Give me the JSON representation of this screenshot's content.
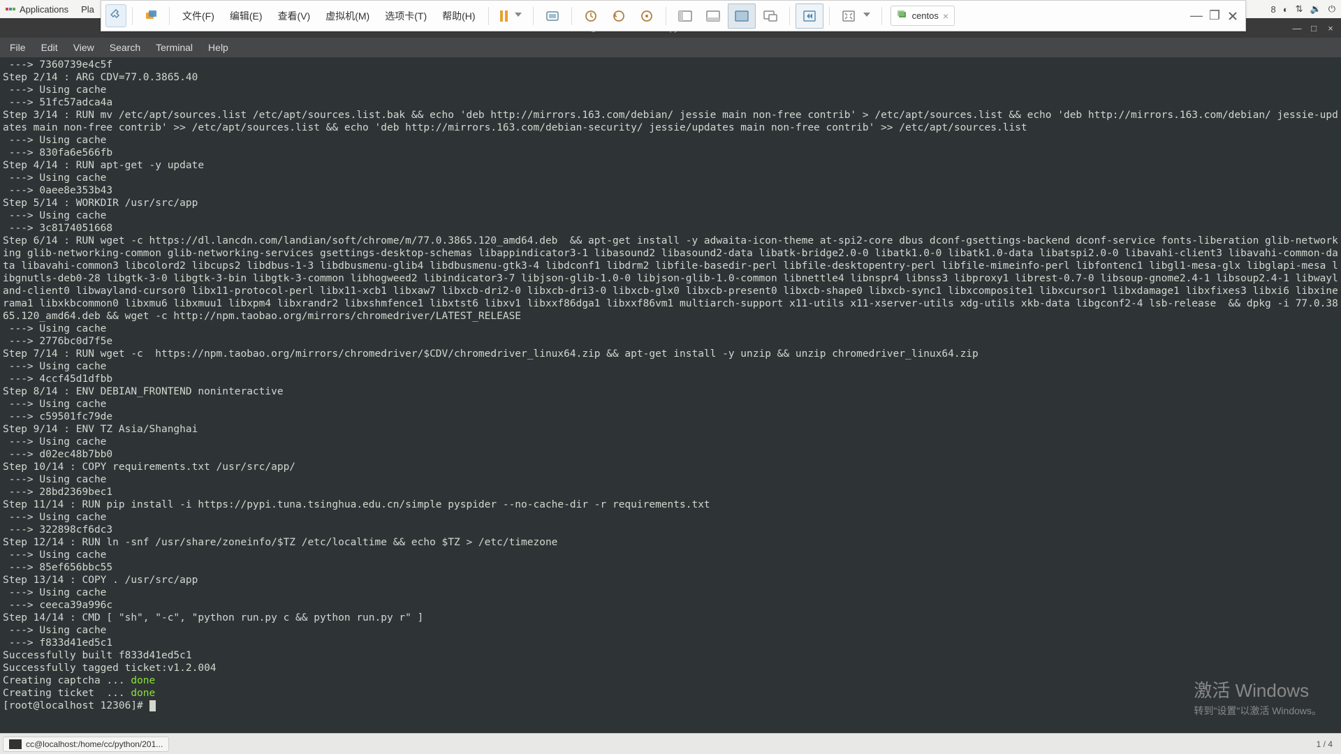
{
  "gnome": {
    "applications": "Applications",
    "places": "Pla",
    "tray_badge": "8"
  },
  "vm_toolbar": {
    "menus": [
      "文件(F)",
      "编辑(E)",
      "查看(V)",
      "虚拟机(M)",
      "选项卡(T)",
      "帮助(H)"
    ],
    "tab_label": "centos"
  },
  "terminal": {
    "title": "cc@localhost:/home/cc/python/20191225/12306",
    "menubar": [
      "File",
      "Edit",
      "View",
      "Search",
      "Terminal",
      "Help"
    ],
    "lines": [
      " ---> 7360739e4c5f",
      "Step 2/14 : ARG CDV=77.0.3865.40",
      " ---> Using cache",
      " ---> 51fc57adca4a",
      "Step 3/14 : RUN mv /etc/apt/sources.list /etc/apt/sources.list.bak && echo 'deb http://mirrors.163.com/debian/ jessie main non-free contrib' > /etc/apt/sources.list && echo 'deb http://mirrors.163.com/debian/ jessie-updates main non-free contrib' >> /etc/apt/sources.list && echo 'deb http://mirrors.163.com/debian-security/ jessie/updates main non-free contrib' >> /etc/apt/sources.list",
      " ---> Using cache",
      " ---> 830fa6e566fb",
      "Step 4/14 : RUN apt-get -y update",
      " ---> Using cache",
      " ---> 0aee8e353b43",
      "Step 5/14 : WORKDIR /usr/src/app",
      " ---> Using cache",
      " ---> 3c8174051668",
      "Step 6/14 : RUN wget -c https://dl.lancdn.com/landian/soft/chrome/m/77.0.3865.120_amd64.deb  && apt-get install -y adwaita-icon-theme at-spi2-core dbus dconf-gsettings-backend dconf-service fonts-liberation glib-networking glib-networking-common glib-networking-services gsettings-desktop-schemas libappindicator3-1 libasound2 libasound2-data libatk-bridge2.0-0 libatk1.0-0 libatk1.0-data libatspi2.0-0 libavahi-client3 libavahi-common-data libavahi-common3 libcolord2 libcups2 libdbus-1-3 libdbusmenu-glib4 libdbusmenu-gtk3-4 libdconf1 libdrm2 libfile-basedir-perl libfile-desktopentry-perl libfile-mimeinfo-perl libfontenc1 libgl1-mesa-glx libglapi-mesa libgnutls-deb0-28 libgtk-3-0 libgtk-3-bin libgtk-3-common libhogweed2 libindicator3-7 libjson-glib-1.0-0 libjson-glib-1.0-common libnettle4 libnspr4 libnss3 libproxy1 librest-0.7-0 libsoup-gnome2.4-1 libsoup2.4-1 libwayland-client0 libwayland-cursor0 libx11-protocol-perl libx11-xcb1 libxaw7 libxcb-dri2-0 libxcb-dri3-0 libxcb-glx0 libxcb-present0 libxcb-shape0 libxcb-sync1 libxcomposite1 libxcursor1 libxdamage1 libxfixes3 libxi6 libxinerama1 libxkbcommon0 libxmu6 libxmuu1 libxpm4 libxrandr2 libxshmfence1 libxtst6 libxv1 libxxf86dga1 libxxf86vm1 multiarch-support x11-utils x11-xserver-utils xdg-utils xkb-data libgconf2-4 lsb-release  && dpkg -i 77.0.3865.120_amd64.deb && wget -c http://npm.taobao.org/mirrors/chromedriver/LATEST_RELEASE",
      " ---> Using cache",
      " ---> 2776bc0d7f5e",
      "Step 7/14 : RUN wget -c  https://npm.taobao.org/mirrors/chromedriver/$CDV/chromedriver_linux64.zip && apt-get install -y unzip && unzip chromedriver_linux64.zip",
      " ---> Using cache",
      " ---> 4ccf45d1dfbb",
      "Step 8/14 : ENV DEBIAN_FRONTEND noninteractive",
      " ---> Using cache",
      " ---> c59501fc79de",
      "Step 9/14 : ENV TZ Asia/Shanghai",
      " ---> Using cache",
      " ---> d02ec48b7bb0",
      "Step 10/14 : COPY requirements.txt /usr/src/app/",
      " ---> Using cache",
      " ---> 28bd2369bec1",
      "Step 11/14 : RUN pip install -i https://pypi.tuna.tsinghua.edu.cn/simple pyspider --no-cache-dir -r requirements.txt",
      " ---> Using cache",
      " ---> 322898cf6dc3",
      "Step 12/14 : RUN ln -snf /usr/share/zoneinfo/$TZ /etc/localtime && echo $TZ > /etc/timezone",
      " ---> Using cache",
      " ---> 85ef656bbc55",
      "Step 13/14 : COPY . /usr/src/app",
      " ---> Using cache",
      " ---> ceeca39a996c",
      "Step 14/14 : CMD [ \"sh\", \"-c\", \"python run.py c && python run.py r\" ]",
      " ---> Using cache",
      " ---> f833d41ed5c1",
      "Successfully built f833d41ed5c1",
      "Successfully tagged ticket:v1.2.004"
    ],
    "creating_captcha": "Creating captcha ... ",
    "creating_ticket": "Creating ticket  ... ",
    "done": "done",
    "prompt": "[root@localhost 12306]# "
  },
  "taskbar": {
    "task_label": "cc@localhost:/home/cc/python/201...",
    "workspace": "1 / 4"
  },
  "watermark": {
    "title": "激活 Windows",
    "sub": "转到\"设置\"以激活 Windows。"
  }
}
